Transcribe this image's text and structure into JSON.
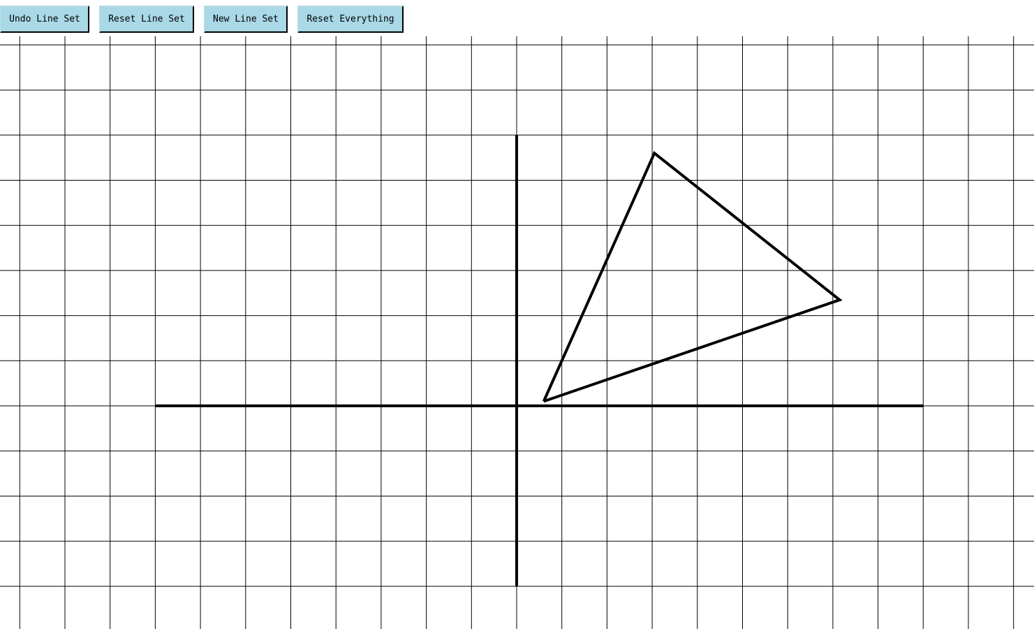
{
  "toolbar": {
    "undo_label": "Undo Line Set",
    "reset_line_set_label": "Reset Line Set",
    "new_line_set_label": "New Line Set",
    "reset_everything_label": "Reset Everything"
  },
  "colors": {
    "button_bg": "#a9d8e6",
    "grid_line": "#000000",
    "drawn_line": "#000000",
    "canvas_bg": "#ffffff"
  },
  "drawing": {
    "line_sets": [
      {
        "name": "horizontal-axis",
        "points": [
          [
            -8,
            0
          ],
          [
            9,
            0
          ]
        ]
      },
      {
        "name": "vertical-axis",
        "points": [
          [
            0,
            6
          ],
          [
            0,
            -4
          ]
        ]
      },
      {
        "name": "triangle",
        "points": [
          [
            0.6,
            0.1
          ],
          [
            3.05,
            5.6
          ],
          [
            7.15,
            2.35
          ],
          [
            0.6,
            0.1
          ]
        ]
      }
    ]
  }
}
